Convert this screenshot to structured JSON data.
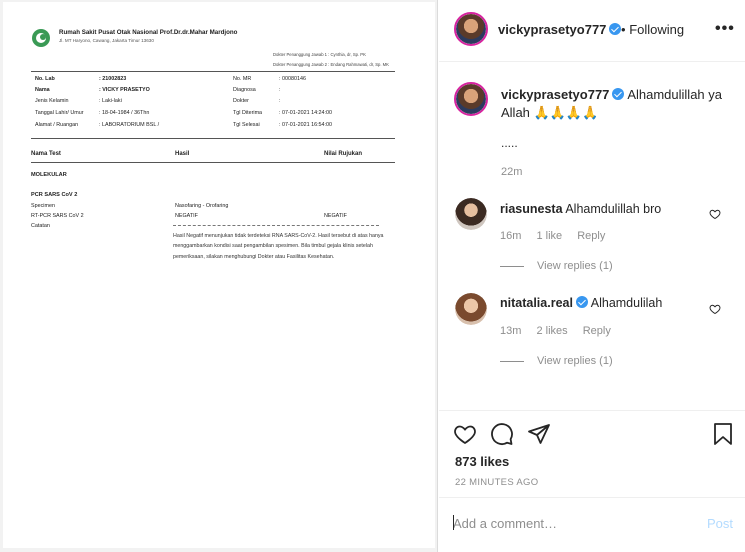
{
  "document": {
    "hospital_name": "Rumah Sakit Pusat Otak Nasional Prof.Dr.dr.Mahar Mardjono",
    "hospital_address": "Jl. MT Haryono, Cawang, Jakarta Timur 13630",
    "doctor_1": "Dokter Penanggung Jawab 1 : Cynthia, dr, Sp. PK",
    "doctor_2": "Dokter Penanggung Jawab 2 : Endang Rahmawati, dr, Sp. MK",
    "fields": {
      "no_lab_label": "No. Lab",
      "no_lab_value": ": 21002823",
      "nama_label": "Nama",
      "nama_value": ": VICKY PRASETYO",
      "jk_label": "Jenis Kelamin",
      "jk_value": ": Laki-laki",
      "tgl_label": "Tanggal Lahir/ Umur",
      "tgl_value": ": 18-04-1984 / 36Thn",
      "alamat_label": "Alamat / Ruangan",
      "alamat_value": ": LABORATORIUM BSL /",
      "no_mr_label": "No. MR",
      "no_mr_value": ": 00080146",
      "diagnosa_label": "Diagnosa",
      "diagnosa_value": ":",
      "dokter_label": "Dokter",
      "dokter_value": ":",
      "tgl_diterima_label": "Tgl Diterima",
      "tgl_diterima_value": ": 07-01-2021 14:24:00",
      "tgl_selesai_label": "Tgl Selesai",
      "tgl_selesai_value": ": 07-01-2021 16:54:00"
    },
    "table_headers": {
      "test": "Nama Test",
      "hasil": "Hasil",
      "rujukan": "Nilai Rujukan"
    },
    "section": "MOLEKULAR",
    "subsection": "PCR SARS CoV 2",
    "rows": {
      "specimen_label": "Specimen",
      "specimen_value": "Nasofaring - Orofaring",
      "rtpcr_label": "RT-PCR  SARS CoV 2",
      "rtpcr_value": "NEGATIF",
      "rtpcr_ref": "NEGATIF",
      "catatan_label": "Catatan"
    },
    "note": "Hasil Negatif menunjukan tidak terdeteksi RNA SARS-CoV-2. Hasil tersebut di atas hanya menggambarkan kondisi saat pengambilan spesimen. Bila timbul gejala klinis setelah pemeriksaan, silakan menghubungi Dokter atau Fasilitas Kesehatan."
  },
  "header": {
    "username": "vickyprasetyo777",
    "separator": "•",
    "follow_status": "Following",
    "more_icon": "more-horizontal-icon"
  },
  "caption": {
    "username": "vickyprasetyo777",
    "text": "Alhamdulillah ya Allah 🙏🙏🙏🙏",
    "extra": ".....",
    "time": "22m"
  },
  "comments": [
    {
      "username": "riasunesta",
      "text": "Alhamdulillah bro",
      "time": "16m",
      "likes": "1 like",
      "reply": "Reply",
      "view_replies": "View replies (1)"
    },
    {
      "username": "nitatalia.real",
      "text": "Alhamdulilah",
      "time": "13m",
      "likes": "2 likes",
      "reply": "Reply",
      "view_replies": "View replies (1)"
    }
  ],
  "actions": {
    "icons": [
      "heart-icon",
      "comment-icon",
      "share-icon",
      "bookmark-icon"
    ],
    "likes": "873 likes",
    "posted_ago": "22 MINUTES AGO"
  },
  "add_comment": {
    "placeholder": "Add a comment…",
    "post_label": "Post"
  },
  "colors": {
    "verified": "#3897f0",
    "post_disabled": "#b3dbff",
    "muted": "#8e8e8e"
  }
}
